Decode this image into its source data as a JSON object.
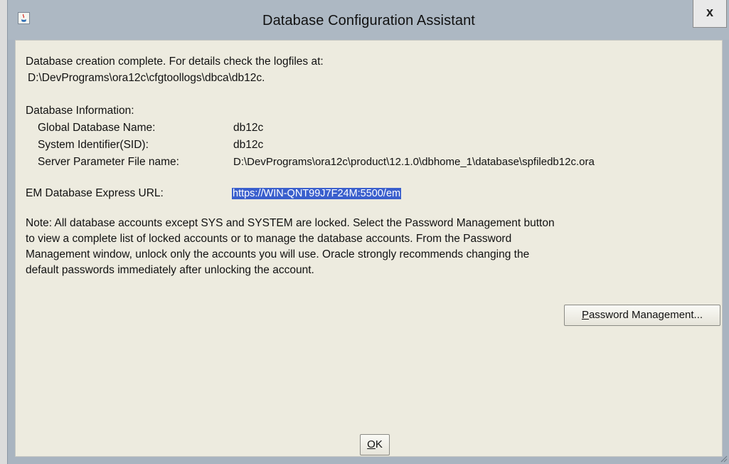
{
  "window": {
    "title": "Database Configuration Assistant",
    "close_label": "x"
  },
  "content": {
    "completion_line1": "Database creation complete. For details check the logfiles at:",
    "completion_line2": "D:\\DevPrograms\\ora12c\\cfgtoollogs\\dbca\\db12c.",
    "info_header": "Database Information:",
    "info_rows": [
      {
        "label": "Global Database Name:",
        "value": "db12c"
      },
      {
        "label": "System Identifier(SID):",
        "value": "db12c"
      },
      {
        "label": "Server Parameter File name:",
        "value": "D:\\DevPrograms\\ora12c\\product\\12.1.0\\dbhome_1\\database\\spfiledb12c.ora"
      }
    ],
    "em_label": "EM Database Express URL:",
    "em_url": "https://WIN-QNT99J7F24M:5500/em",
    "note_lines": [
      "Note: All database accounts except SYS and SYSTEM are locked. Select the Password Management button",
      "to view a complete list of locked accounts or to manage the database accounts. From the Password",
      "Management window, unlock only the accounts you will use. Oracle strongly recommends changing the",
      "default passwords immediately after unlocking the account."
    ]
  },
  "buttons": {
    "password_management": "Password Management...",
    "ok": "OK"
  },
  "colors": {
    "selection": "#3a5fcd",
    "dialog_bg": "#edebdf",
    "titlebar": "#adb8c3"
  }
}
